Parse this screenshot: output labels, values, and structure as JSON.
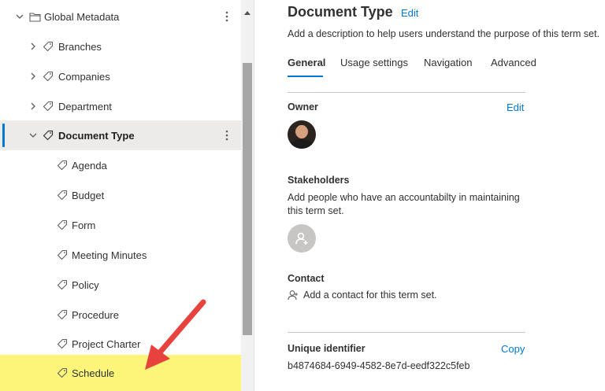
{
  "tree": {
    "root": {
      "label": "Global Metadata",
      "icon": "folder-icon"
    },
    "sets": [
      {
        "label": "Branches",
        "icon": "tag-icon"
      },
      {
        "label": "Companies",
        "icon": "tag-icon"
      },
      {
        "label": "Department",
        "icon": "tag-icon"
      },
      {
        "label": "Document Type",
        "icon": "tag-icon"
      }
    ],
    "terms": [
      {
        "label": "Agenda"
      },
      {
        "label": "Budget"
      },
      {
        "label": "Form"
      },
      {
        "label": "Meeting Minutes"
      },
      {
        "label": "Policy"
      },
      {
        "label": "Procedure"
      },
      {
        "label": "Project Charter"
      },
      {
        "label": "Schedule"
      }
    ]
  },
  "detail": {
    "title": "Document Type",
    "title_edit": "Edit",
    "description": "Add a description to help users understand the purpose of this term set.",
    "tabs": [
      {
        "label": "General"
      },
      {
        "label": "Usage settings"
      },
      {
        "label": "Navigation"
      },
      {
        "label": "Advanced"
      }
    ],
    "owner": {
      "title": "Owner",
      "edit": "Edit"
    },
    "stakeholders": {
      "title": "Stakeholders",
      "text": "Add people who have an accountabilty in maintaining this term set."
    },
    "contact": {
      "title": "Contact",
      "text": "Add a contact for this term set."
    },
    "unique_identifier": {
      "title": "Unique identifier",
      "copy": "Copy",
      "value": "b4874684-6949-4582-8e7d-eedf322c5feb"
    }
  },
  "colors": {
    "accent": "#0078d4",
    "selected_row": "#edebe9",
    "highlight": "#fbf67a",
    "annotation_arrow": "#e8423f"
  }
}
